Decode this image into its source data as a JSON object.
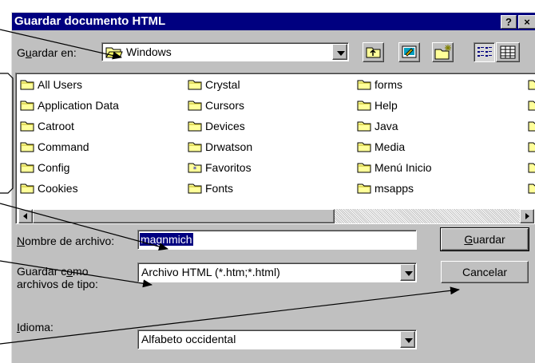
{
  "title": "Guardar documento HTML",
  "help_button": "?",
  "close_button": "×",
  "save_in": {
    "label": "Guardar en:",
    "value": "Windows"
  },
  "files": [
    {
      "name": "All Users",
      "col": 0,
      "row": 0
    },
    {
      "name": "Application Data",
      "col": 0,
      "row": 1
    },
    {
      "name": "Catroot",
      "col": 0,
      "row": 2
    },
    {
      "name": "Command",
      "col": 0,
      "row": 3
    },
    {
      "name": "Config",
      "col": 0,
      "row": 4
    },
    {
      "name": "Cookies",
      "col": 0,
      "row": 5
    },
    {
      "name": "Crystal",
      "col": 1,
      "row": 0
    },
    {
      "name": "Cursors",
      "col": 1,
      "row": 1
    },
    {
      "name": "Devices",
      "col": 1,
      "row": 2
    },
    {
      "name": "Drwatson",
      "col": 1,
      "row": 3
    },
    {
      "name": "Favoritos",
      "col": 1,
      "row": 4,
      "special": true
    },
    {
      "name": "Fonts",
      "col": 1,
      "row": 5
    },
    {
      "name": "forms",
      "col": 2,
      "row": 0
    },
    {
      "name": "Help",
      "col": 2,
      "row": 1
    },
    {
      "name": "Java",
      "col": 2,
      "row": 2
    },
    {
      "name": "Media",
      "col": 2,
      "row": 3
    },
    {
      "name": "Menú Inicio",
      "col": 2,
      "row": 4
    },
    {
      "name": "msapps",
      "col": 2,
      "row": 5
    }
  ],
  "filename": {
    "label": "Nombre de archivo:",
    "value": "magnmich"
  },
  "save_as_type": {
    "label_line1": "Guardar como",
    "label_line2": "archivos de tipo:",
    "value": "Archivo HTML (*.htm;*.html)"
  },
  "language": {
    "label": "Idioma:",
    "value": "Alfabeto occidental"
  },
  "buttons": {
    "save": "Guardar",
    "cancel": "Cancelar"
  },
  "colors": {
    "titlebar": "#000080",
    "face": "#c0c0c0",
    "folder": "#ffff99",
    "arrow": "#000000"
  }
}
